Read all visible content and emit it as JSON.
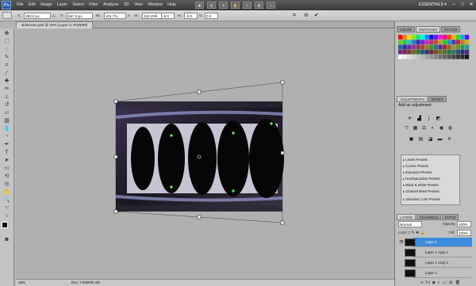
{
  "app": {
    "logo": "Ps"
  },
  "menubar": {
    "items": [
      "File",
      "Edit",
      "Image",
      "Layer",
      "Select",
      "Filter",
      "Analysis",
      "3D",
      "View",
      "Window",
      "Help"
    ],
    "workspace": "ESSENTIALS ▾"
  },
  "options": {
    "x_label": "X:",
    "x_value": "393.0 px",
    "y_label": "Y:",
    "y_value": "667.5 px",
    "w_label": "W:",
    "w_value": "101.7%",
    "h_label": "H:",
    "h_value": "122.2%",
    "angle_value": "-6.0",
    "h_skew_label": "H:",
    "h_skew_value": "-6.9",
    "v_skew_label": "V:",
    "v_skew_value": "0.0"
  },
  "document": {
    "tab": "sinkmoon.psd @ 25% (Layer 2, RGB/8#)",
    "zoom": "25%",
    "doc_info": "Doc: 7.60M/35.4M"
  },
  "panels": {
    "color_tabs": [
      "COLOR",
      "SWATCHES",
      "STYLES"
    ],
    "adjust_tabs": [
      "ADJUSTMENTS",
      "MASKS"
    ],
    "adjust_title": "Add an adjustment",
    "presets": [
      "Levels Presets",
      "Curves Presets",
      "Exposure Presets",
      "Hue/Saturation Presets",
      "Black & White Presets",
      "Channel Mixer Presets",
      "Selective Color Presets"
    ],
    "layers_tabs": [
      "LAYERS",
      "CHANNELS",
      "PATHS"
    ],
    "blend_mode": "Normal",
    "opacity_label": "Opacity:",
    "opacity_value": "100%",
    "lock_label": "Lock:",
    "fill_label": "Fill:",
    "fill_value": "100%",
    "layers": [
      "Layer 2",
      "Layer 1 copy 4",
      "Layer 1 copy 3",
      "Layer 1"
    ]
  },
  "colors": {
    "accent": "#3b8cdc",
    "canvas": "#b0b0b0"
  }
}
